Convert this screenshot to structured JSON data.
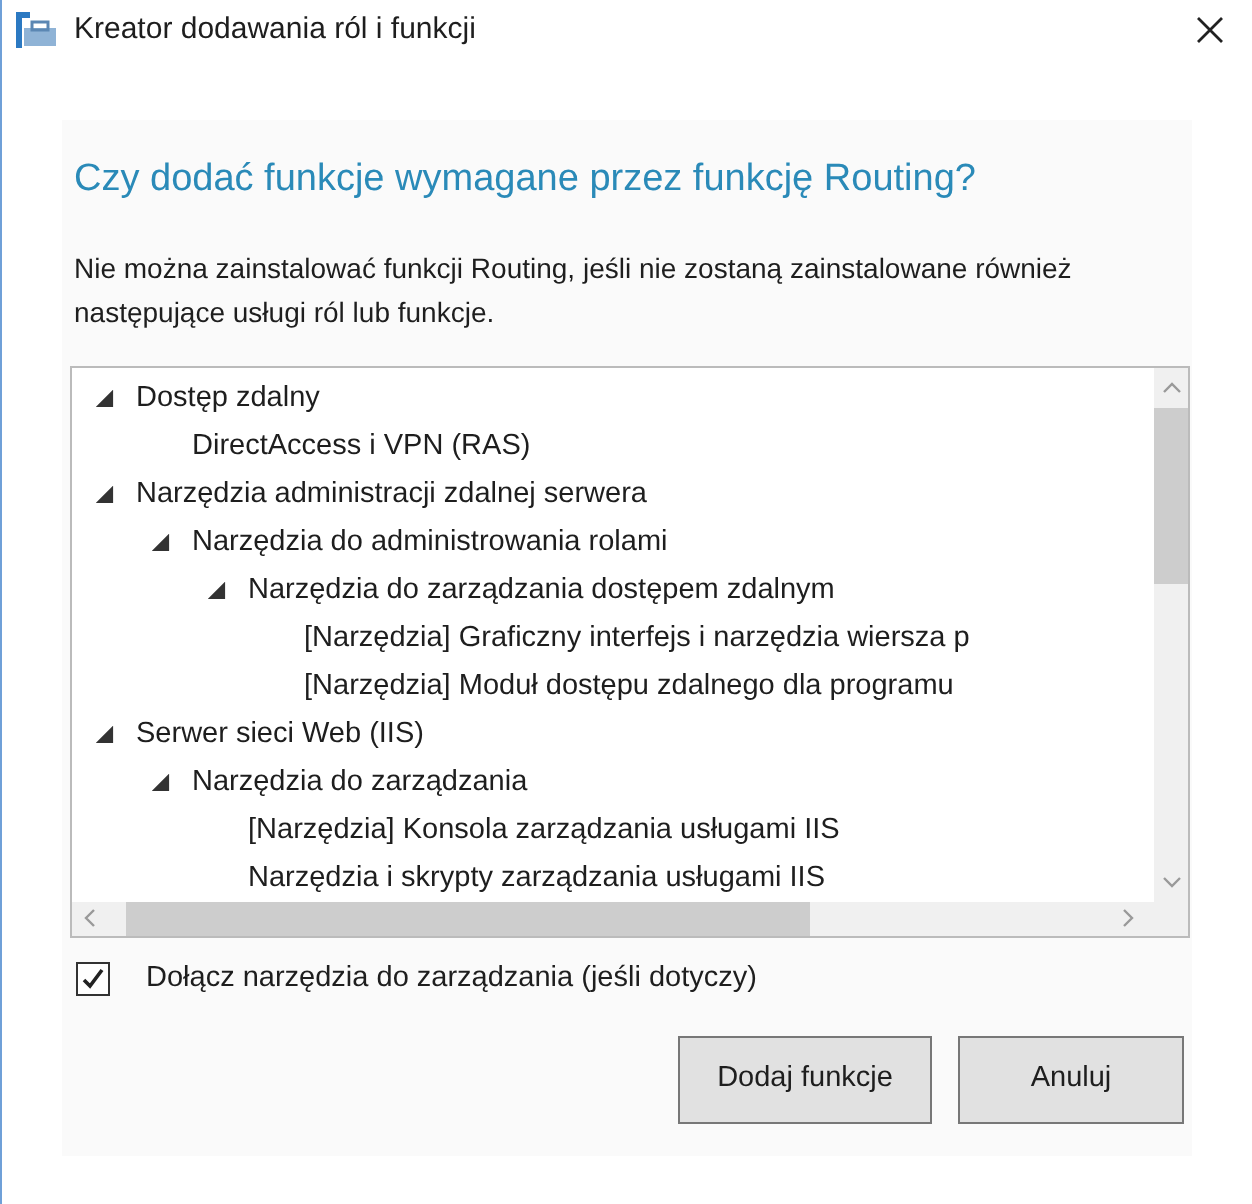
{
  "window": {
    "title": "Kreator dodawania ról i funkcji"
  },
  "heading": "Czy dodać funkcje wymagane przez funkcję Routing?",
  "description": "Nie można zainstalować funkcji Routing, jeśli nie zostaną zainstalowane również następujące usługi ról lub funkcje.",
  "tree": [
    {
      "label": "Dostęp zdalny",
      "expanded": true,
      "children": [
        {
          "label": "DirectAccess i VPN (RAS)"
        }
      ]
    },
    {
      "label": "Narzędzia administracji zdalnej serwera",
      "expanded": true,
      "children": [
        {
          "label": "Narzędzia do administrowania rolami",
          "expanded": true,
          "children": [
            {
              "label": "Narzędzia do zarządzania dostępem zdalnym",
              "expanded": true,
              "children": [
                {
                  "label": "[Narzędzia] Graficzny interfejs i narzędzia wiersza p"
                },
                {
                  "label": "[Narzędzia] Moduł dostępu zdalnego dla programu"
                }
              ]
            }
          ]
        }
      ]
    },
    {
      "label": "Serwer sieci Web (IIS)",
      "expanded": true,
      "children": [
        {
          "label": "Narzędzia do zarządzania",
          "expanded": true,
          "children": [
            {
              "label": "[Narzędzia] Konsola zarządzania usługami IIS"
            },
            {
              "label": "Narzędzia i skrypty zarządzania usługami IIS"
            }
          ]
        }
      ]
    }
  ],
  "include_tools": {
    "label": "Dołącz narzędzia do zarządzania (jeśli dotyczy)",
    "checked": true
  },
  "buttons": [
    "Dodaj funkcje",
    "Anuluj"
  ]
}
